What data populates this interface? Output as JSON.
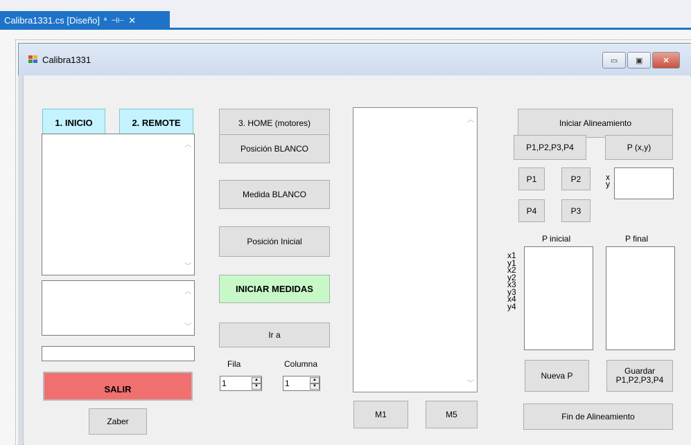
{
  "tab": {
    "title": "Calibra1331.cs [Diseño]",
    "pin_glyph": "ª",
    "dock_glyph": "⊣⊢",
    "close_glyph": "✕"
  },
  "window": {
    "title": "Calibra1331",
    "minimize": "▭",
    "maximize": "▣",
    "close": "✕"
  },
  "left": {
    "inicio": "1. INICIO",
    "remote": "2. REMOTE",
    "text_field_value": "",
    "salir": "SALIR",
    "zaber": "Zaber"
  },
  "middle": {
    "home": "3. HOME (motores)",
    "posicion_blanco": "Posición BLANCO",
    "medida_blanco": "Medida BLANCO",
    "posicion_inicial": "Posición Inicial",
    "iniciar_medidas": "INICIAR MEDIDAS",
    "ir_a": "Ir a",
    "fila_label": "Fila",
    "columna_label": "Columna",
    "fila_value": "1",
    "columna_value": "1"
  },
  "list": {
    "m1": "M1",
    "m5": "M5"
  },
  "right": {
    "iniciar_alineamiento": "Iniciar Alineamiento",
    "p1234": "P1,P2,P3,P4",
    "pxy": "P (x,y)",
    "p1": "P1",
    "p2": "P2",
    "p4": "P4",
    "p3": "P3",
    "x_label": "x",
    "y_label": "y",
    "p_inicial": "P inicial",
    "p_final": "P final",
    "coords": [
      "x1",
      "y1",
      "x2",
      "y2",
      "x3",
      "y3",
      "x4",
      "y4"
    ],
    "nueva_p": "Nueva P",
    "guardar_line1": "Guardar",
    "guardar_line2": "P1,P2,P3,P4",
    "fin_alineamiento": "Fin de Alineamiento"
  },
  "colors": {
    "accent_tab": "#1e73c8",
    "cyan_button": "#c4f3ff",
    "green_button": "#c8f8c8",
    "red_button": "#f07070"
  }
}
